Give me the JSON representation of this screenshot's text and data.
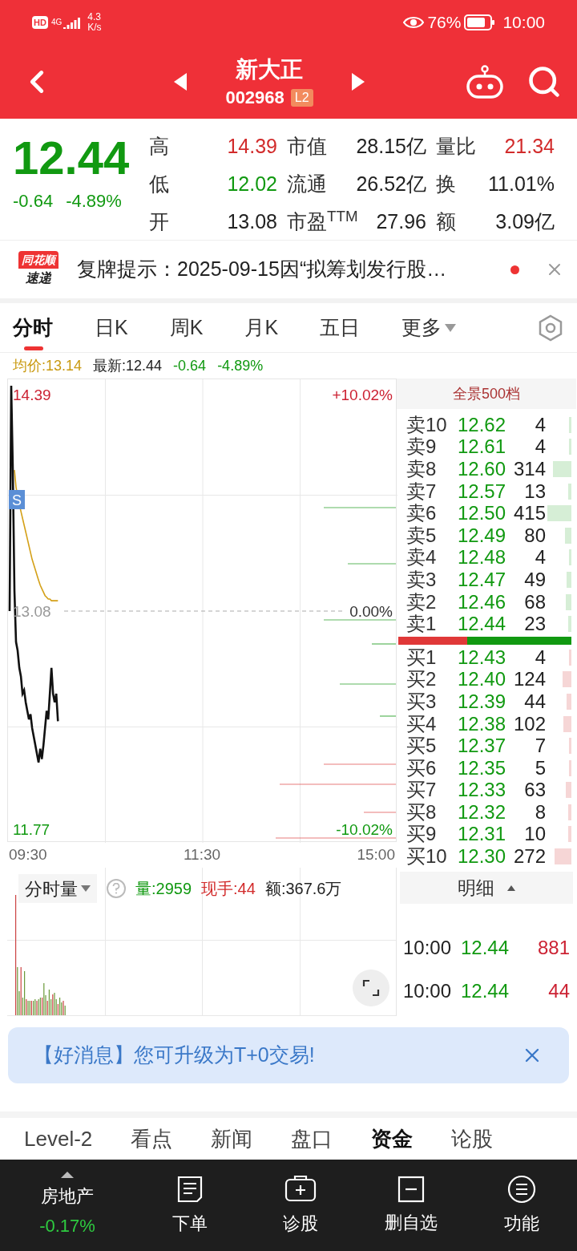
{
  "status_bar": {
    "hd": "HD",
    "network": "4G",
    "speed": [
      "4.3",
      "K/s"
    ],
    "battery": "76%",
    "time": "10:00"
  },
  "header": {
    "name": "新大正",
    "code": "002968",
    "badge": "L2"
  },
  "quote": {
    "price": "12.44",
    "change": "-0.64",
    "change_pct": "-4.89%",
    "color": "#119911",
    "stats": [
      {
        "label": "高",
        "value": "14.39",
        "color": "#d22b2b"
      },
      {
        "label": "市值",
        "value": "28.15亿",
        "color": "#222222"
      },
      {
        "label": "量比",
        "value": "21.34",
        "color": "#d22b2b"
      },
      {
        "label": "低",
        "value": "12.02",
        "color": "#119911"
      },
      {
        "label": "流通",
        "value": "26.52亿",
        "color": "#222222"
      },
      {
        "label": "换",
        "value": "11.01%",
        "color": "#222222"
      },
      {
        "label": "开",
        "value": "13.08",
        "color": "#222222"
      },
      {
        "label": "市盈$^{TTM}$",
        "value": "27.96",
        "color": "#222222"
      },
      {
        "label": "额",
        "value": "3.09亿",
        "color": "#222222"
      }
    ]
  },
  "news": {
    "logo": [
      "同花顺",
      "速递"
    ],
    "text": "复牌提示：2025-09-15因“拟筹划发行股…",
    "unread": true
  },
  "tabs": [
    {
      "label": "分时",
      "selected": true
    },
    {
      "label": "日K",
      "selected": false
    },
    {
      "label": "周K",
      "selected": false
    },
    {
      "label": "月K",
      "selected": false
    },
    {
      "label": "五日",
      "selected": false
    },
    {
      "label": "更多",
      "selected": false,
      "kind": "menu"
    }
  ],
  "info_line": [
    {
      "text": "均价:13.14",
      "color": "#c99a12"
    },
    {
      "text": "最新:12.44",
      "color": "#222222"
    },
    {
      "text": "-0.64",
      "color": "#119911"
    },
    {
      "text": "-4.89%",
      "color": "#119911"
    }
  ],
  "chart": {
    "left_labels": [
      "14.39",
      "13.08",
      "11.77"
    ],
    "right_labels": [
      "+10.02%",
      "0.00%",
      "-10.02%"
    ],
    "time_labels": [
      "09:30",
      "11:30",
      "15:00"
    ],
    "marker": "S"
  },
  "order_book": {
    "title": "全景500档",
    "bid_ratio": {
      "level": 0.4
    },
    "asks": [
      {
        "label": "卖10",
        "price": "12.62",
        "qty": "4"
      },
      {
        "label": "卖9",
        "price": "12.61",
        "qty": "4"
      },
      {
        "label": "卖8",
        "price": "12.60",
        "qty": "314"
      },
      {
        "label": "卖7",
        "price": "12.57",
        "qty": "13"
      },
      {
        "label": "卖6",
        "price": "12.50",
        "qty": "415"
      },
      {
        "label": "卖5",
        "price": "12.49",
        "qty": "80"
      },
      {
        "label": "卖4",
        "price": "12.48",
        "qty": "4"
      },
      {
        "label": "卖3",
        "price": "12.47",
        "qty": "49"
      },
      {
        "label": "卖2",
        "price": "12.46",
        "qty": "68"
      },
      {
        "label": "卖1",
        "price": "12.44",
        "qty": "23"
      }
    ],
    "bids": [
      {
        "label": "买1",
        "price": "12.43",
        "qty": "4"
      },
      {
        "label": "买2",
        "price": "12.40",
        "qty": "124"
      },
      {
        "label": "买3",
        "price": "12.39",
        "qty": "44"
      },
      {
        "label": "买4",
        "price": "12.38",
        "qty": "102"
      },
      {
        "label": "买5",
        "price": "12.37",
        "qty": "7"
      },
      {
        "label": "买6",
        "price": "12.35",
        "qty": "5"
      },
      {
        "label": "买7",
        "price": "12.33",
        "qty": "63"
      },
      {
        "label": "买8",
        "price": "12.32",
        "qty": "8"
      },
      {
        "label": "买9",
        "price": "12.31",
        "qty": "10"
      },
      {
        "label": "买10",
        "price": "12.30",
        "qty": "272"
      }
    ]
  },
  "volume": {
    "selector": "分时量",
    "fields": [
      {
        "text": "量:2959",
        "color": "#119911"
      },
      {
        "text": "现手:44",
        "color": "#d22b2b"
      },
      {
        "text": "额:367.6万",
        "color": "#222222"
      }
    ]
  },
  "trades": {
    "title": "明细",
    "rows": [
      {
        "time": "10:00",
        "price": "12.44",
        "qty": "881"
      },
      {
        "time": "10:00",
        "price": "12.44",
        "qty": "44"
      }
    ]
  },
  "banner": {
    "text": "【好消息】您可升级为T+0交易!"
  },
  "bottom_tabs": [
    {
      "label": "Level-2",
      "selected": false
    },
    {
      "label": "看点",
      "selected": false
    },
    {
      "label": "新闻",
      "selected": false
    },
    {
      "label": "盘口",
      "selected": false
    },
    {
      "label": "资金",
      "selected": true
    },
    {
      "label": "论股",
      "selected": false
    }
  ],
  "toolbar": [
    {
      "kind": "sector",
      "label": "房地产",
      "change": "-0.17%"
    },
    {
      "kind": "order",
      "label": "下单"
    },
    {
      "kind": "diagnose",
      "label": "诊股"
    },
    {
      "kind": "remove",
      "label": "删自选"
    },
    {
      "kind": "menu",
      "label": "功能"
    }
  ]
}
